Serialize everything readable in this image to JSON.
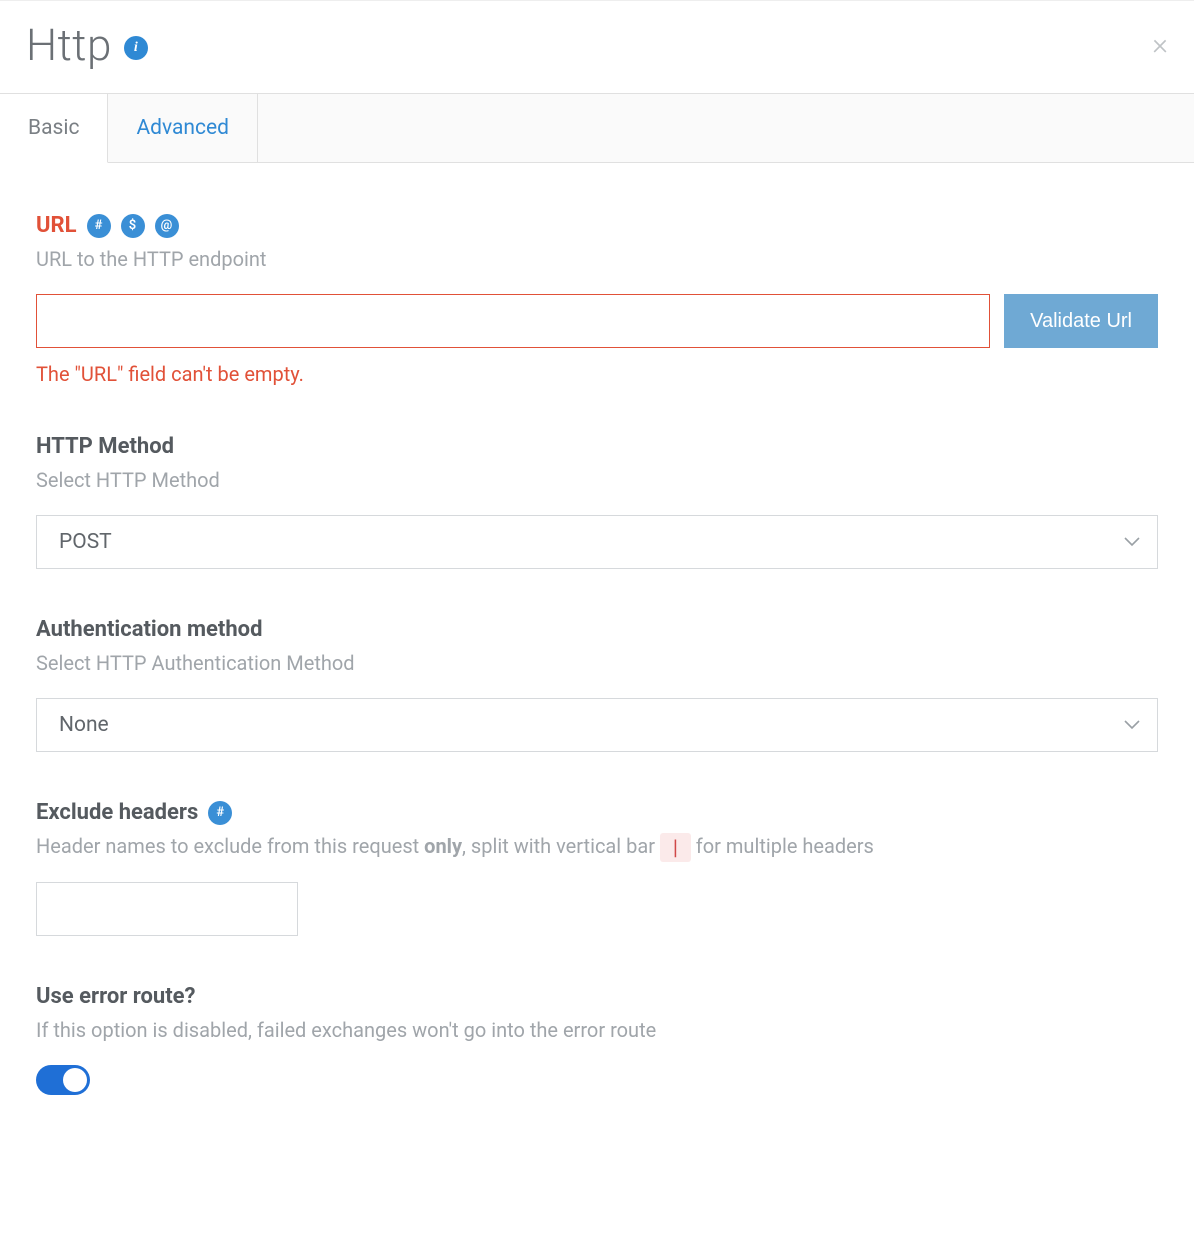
{
  "header": {
    "title": "Http",
    "info_icon": "i",
    "close_icon": "×"
  },
  "tabs": {
    "basic": "Basic",
    "advanced": "Advanced"
  },
  "url_section": {
    "label": "URL",
    "badges": {
      "hash": "#",
      "dollar": "$",
      "at": "@"
    },
    "desc": "URL to the HTTP endpoint",
    "value": "",
    "validate_label": "Validate Url",
    "error": "The \"URL\" field can't be empty."
  },
  "method_section": {
    "label": "HTTP Method",
    "desc": "Select HTTP Method",
    "value": "POST"
  },
  "auth_section": {
    "label": "Authentication method",
    "desc": "Select HTTP Authentication Method",
    "value": "None"
  },
  "exclude_section": {
    "label": "Exclude headers",
    "badges": {
      "hash": "#"
    },
    "desc_pre": "Header names to exclude from this request ",
    "desc_bold": "only",
    "desc_mid": ", split with vertical bar ",
    "pipe": "|",
    "desc_post": " for multiple headers",
    "value": ""
  },
  "error_route_section": {
    "label": "Use error route?",
    "desc": "If this option is disabled, failed exchanges won't go into the error route",
    "enabled": true
  }
}
